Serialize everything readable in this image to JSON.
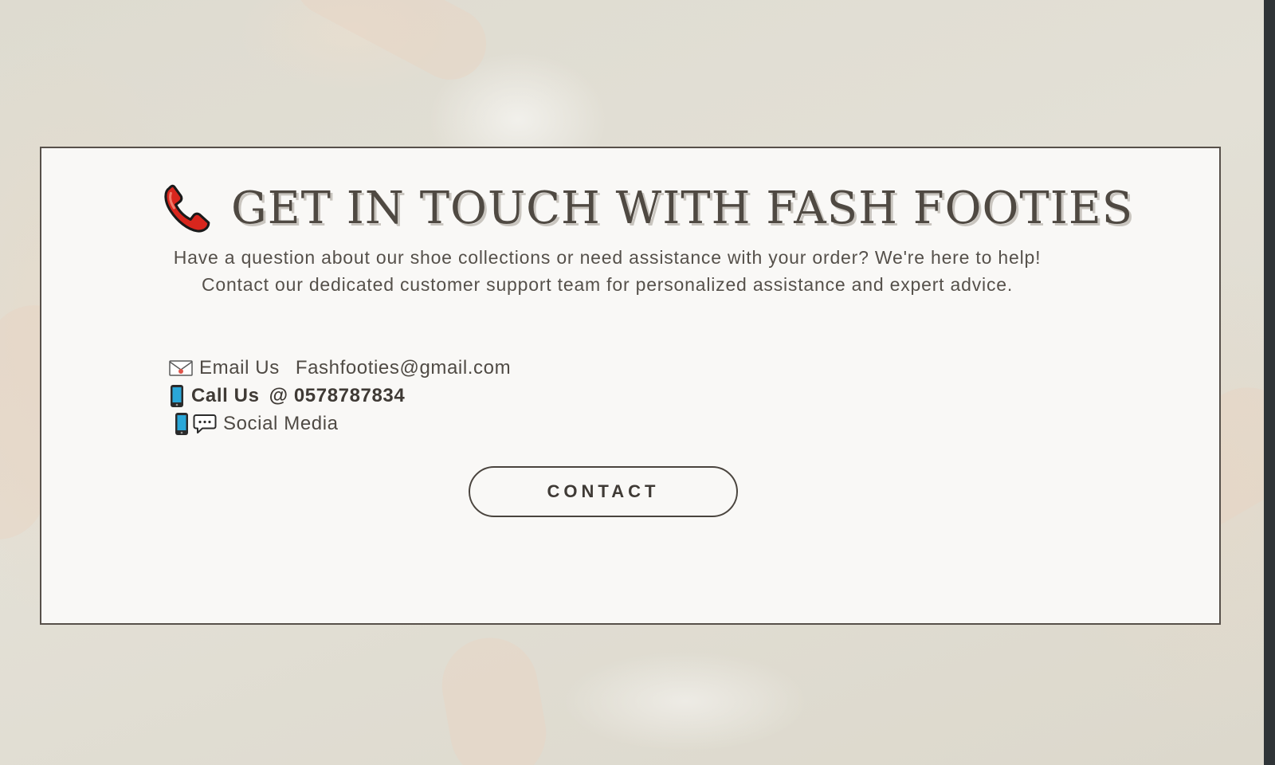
{
  "section": {
    "title": "GET IN TOUCH WITH FASH FOOTIES",
    "title_icon": "telephone-receiver-icon",
    "intro": "Have a question about our shoe collections or need assistance with your order? We're here to help! Contact our dedicated customer support team for personalized assistance and expert advice."
  },
  "contacts": {
    "email_icon": "envelope-icon",
    "email_label": "Email Us",
    "email_value": "Fashfooties@gmail.com",
    "call_icon": "mobile-phone-icon",
    "call_label": "Call Us",
    "call_value": "@ 0578787834",
    "social_icons": [
      "mobile-phone-icon",
      "speech-bubble-icon"
    ],
    "social_label": "Social Media"
  },
  "cta": {
    "label": "CONTACT"
  },
  "colors": {
    "card_border": "#57504a",
    "card_background": "#f9f8f6",
    "text": "#4f4a44",
    "accent_red": "#d8261d"
  }
}
